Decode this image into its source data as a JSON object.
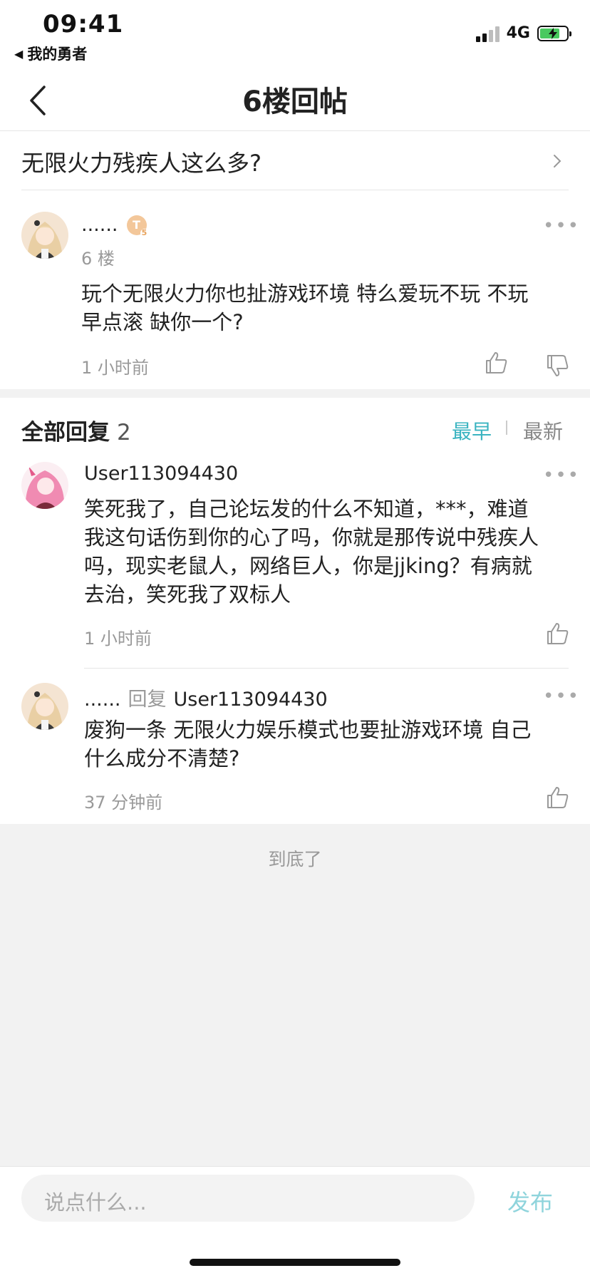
{
  "status_bar": {
    "time": "09:41",
    "back_app": "我的勇者",
    "network": "4G"
  },
  "nav": {
    "title": "6楼回帖"
  },
  "thread": {
    "title": "无限火力残疾人这么多?"
  },
  "floor_post": {
    "author": "......",
    "level_badge": "T",
    "level_sub": "5",
    "floor": "6 楼",
    "content_line1": "玩个无限火力你也扯游戏环境  特么爱玩不玩 不玩",
    "content_line2": "早点滚 缺你一个?",
    "time": "1 小时前"
  },
  "replies_header": {
    "label": "全部回复",
    "count": "2",
    "sort_earliest": "最早",
    "sort_latest": "最新"
  },
  "replies": [
    {
      "author": "User113094430",
      "lines": [
        "笑死我了，自己论坛发的什么不知道，***，难道",
        "我这句话伤到你的心了吗，你就是那传说中残疾人",
        "吗，现实老鼠人，网络巨人，你是jjking？有病就",
        "去治，笑死我了双标人"
      ],
      "time": "1 小时前"
    },
    {
      "author": "......",
      "reply_word": "回复",
      "reply_to": "User113094430",
      "lines": [
        "废狗一条 无限火力娱乐模式也要扯游戏环境  自己",
        "什么成分不清楚?"
      ],
      "time": "37 分钟前"
    }
  ],
  "end_text": "到底了",
  "composer": {
    "placeholder": "说点什么...",
    "publish_label": "发布"
  },
  "icons": {
    "back": "chevron-left-icon",
    "more": "more-dots-icon",
    "like": "thumb-up-icon",
    "dislike": "thumb-down-icon"
  },
  "colors": {
    "accent": "#3bb4c1",
    "publish": "#8fd4dc",
    "text_gray": "#999999",
    "band": "#f2f2f2"
  }
}
